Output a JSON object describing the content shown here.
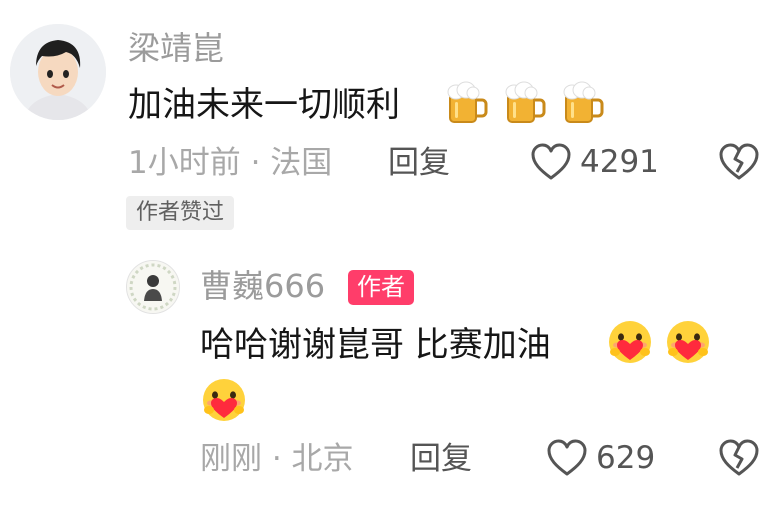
{
  "comment": {
    "username": "梁靖崑",
    "text": "加油未来一切顺利",
    "emoji_name": "beer-mug-icon",
    "emoji_count": 3,
    "meta": "1小时前 · 法国",
    "reply_label": "回复",
    "like_count": "4291",
    "author_liked_chip": "作者赞过"
  },
  "reply": {
    "username": "曹巍666",
    "author_badge": "作者",
    "text": "哈哈谢谢崑哥 比赛加油",
    "emoji_name": "heart-hug-emoji-icon",
    "emoji_count": 3,
    "meta": "刚刚 · 北京",
    "reply_label": "回复",
    "like_count": "629"
  },
  "colors": {
    "username": "#9b9b9b",
    "text": "#161616",
    "meta": "#a8a8a8",
    "action": "#555555",
    "author_badge_bg": "#ff3d6a",
    "chip_bg": "#eeeeee"
  }
}
